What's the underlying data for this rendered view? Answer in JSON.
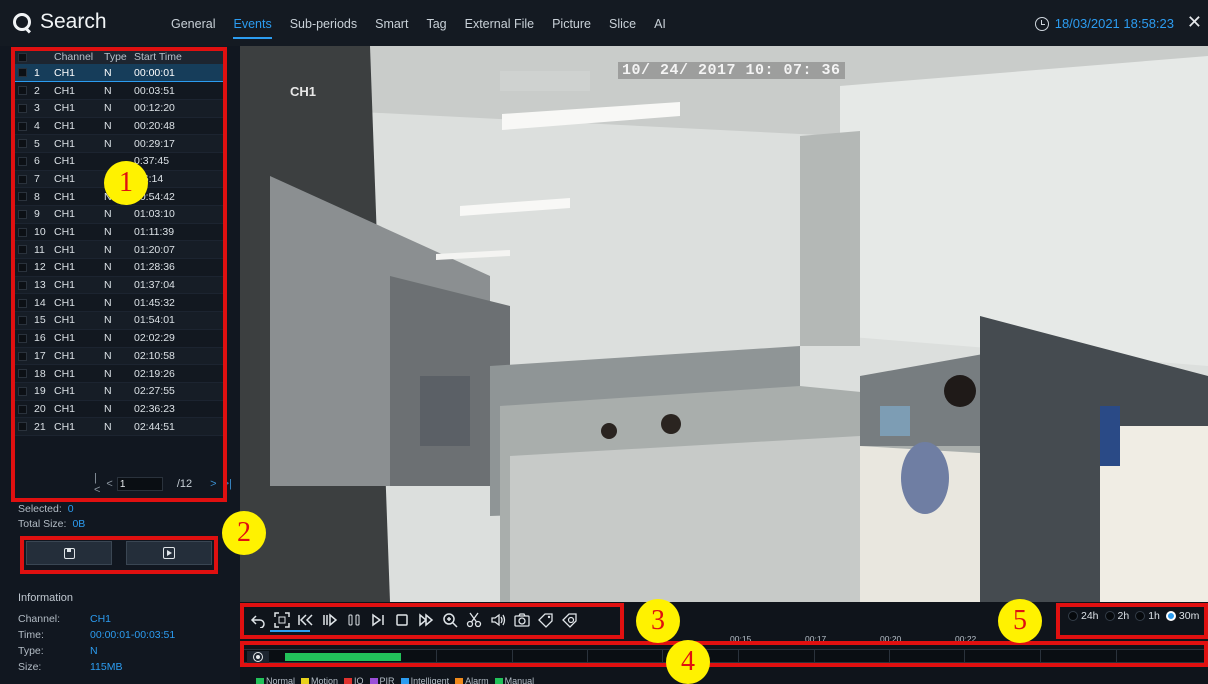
{
  "header": {
    "title": "Search",
    "tabs": [
      "General",
      "Events",
      "Sub-periods",
      "Smart",
      "Tag",
      "External File",
      "Picture",
      "Slice",
      "AI"
    ],
    "active_tab": "Events",
    "datetime": "18/03/2021 18:58:23"
  },
  "event_table": {
    "columns": [
      "Channel",
      "Type",
      "Start Time"
    ],
    "rows": [
      [
        "1",
        "CH1",
        "N",
        "00:00:01"
      ],
      [
        "2",
        "CH1",
        "N",
        "00:03:51"
      ],
      [
        "3",
        "CH1",
        "N",
        "00:12:20"
      ],
      [
        "4",
        "CH1",
        "N",
        "00:20:48"
      ],
      [
        "5",
        "CH1",
        "N",
        "00:29:17"
      ],
      [
        "6",
        "CH1",
        "",
        "0:37:45"
      ],
      [
        "7",
        "CH1",
        "",
        ":46:14"
      ],
      [
        "8",
        "CH1",
        "N",
        "00:54:42"
      ],
      [
        "9",
        "CH1",
        "N",
        "01:03:10"
      ],
      [
        "10",
        "CH1",
        "N",
        "01:11:39"
      ],
      [
        "11",
        "CH1",
        "N",
        "01:20:07"
      ],
      [
        "12",
        "CH1",
        "N",
        "01:28:36"
      ],
      [
        "13",
        "CH1",
        "N",
        "01:37:04"
      ],
      [
        "14",
        "CH1",
        "N",
        "01:45:32"
      ],
      [
        "15",
        "CH1",
        "N",
        "01:54:01"
      ],
      [
        "16",
        "CH1",
        "N",
        "02:02:29"
      ],
      [
        "17",
        "CH1",
        "N",
        "02:10:58"
      ],
      [
        "18",
        "CH1",
        "N",
        "02:19:26"
      ],
      [
        "19",
        "CH1",
        "N",
        "02:27:55"
      ],
      [
        "20",
        "CH1",
        "N",
        "02:36:23"
      ],
      [
        "21",
        "CH1",
        "N",
        "02:44:51"
      ]
    ],
    "selected_row": 0
  },
  "pager": {
    "current": "1",
    "total": "/12"
  },
  "summary": {
    "selected_label": "Selected:",
    "selected_value": "0",
    "size_label": "Total Size:",
    "size_value": "0B"
  },
  "info": {
    "heading": "Information",
    "channel_label": "Channel:",
    "channel": "CH1",
    "time_label": "Time:",
    "time": "00:00:01-00:03:51",
    "type_label": "Type:",
    "type": "N",
    "size_label": "Size:",
    "size": "115MB"
  },
  "video": {
    "osd_timestamp": "10/ 24/ 2017  10: 07: 36",
    "osd_channel": "CH1"
  },
  "scale": {
    "options": [
      "24h",
      "2h",
      "1h",
      "30m"
    ],
    "selected": "30m"
  },
  "timeline": {
    "ticks": [
      "00:15",
      "00:17",
      "00:20",
      "00:22"
    ]
  },
  "legend": [
    {
      "label": "Normal",
      "color": "#22c25a"
    },
    {
      "label": "Motion",
      "color": "#e8d21c"
    },
    {
      "label": "IO",
      "color": "#e0322e"
    },
    {
      "label": "PIR",
      "color": "#9b4fd8"
    },
    {
      "label": "Intelligent",
      "color": "#2c9cf0"
    },
    {
      "label": "Alarm",
      "color": "#f08a1c"
    },
    {
      "label": "Manual",
      "color": "#22c25a"
    }
  ],
  "annotations": [
    "1",
    "2",
    "3",
    "4",
    "5"
  ],
  "colors": {
    "accent": "#2c9cf0",
    "annotation_red": "#e01010",
    "annotation_yellow": "#fff200"
  }
}
